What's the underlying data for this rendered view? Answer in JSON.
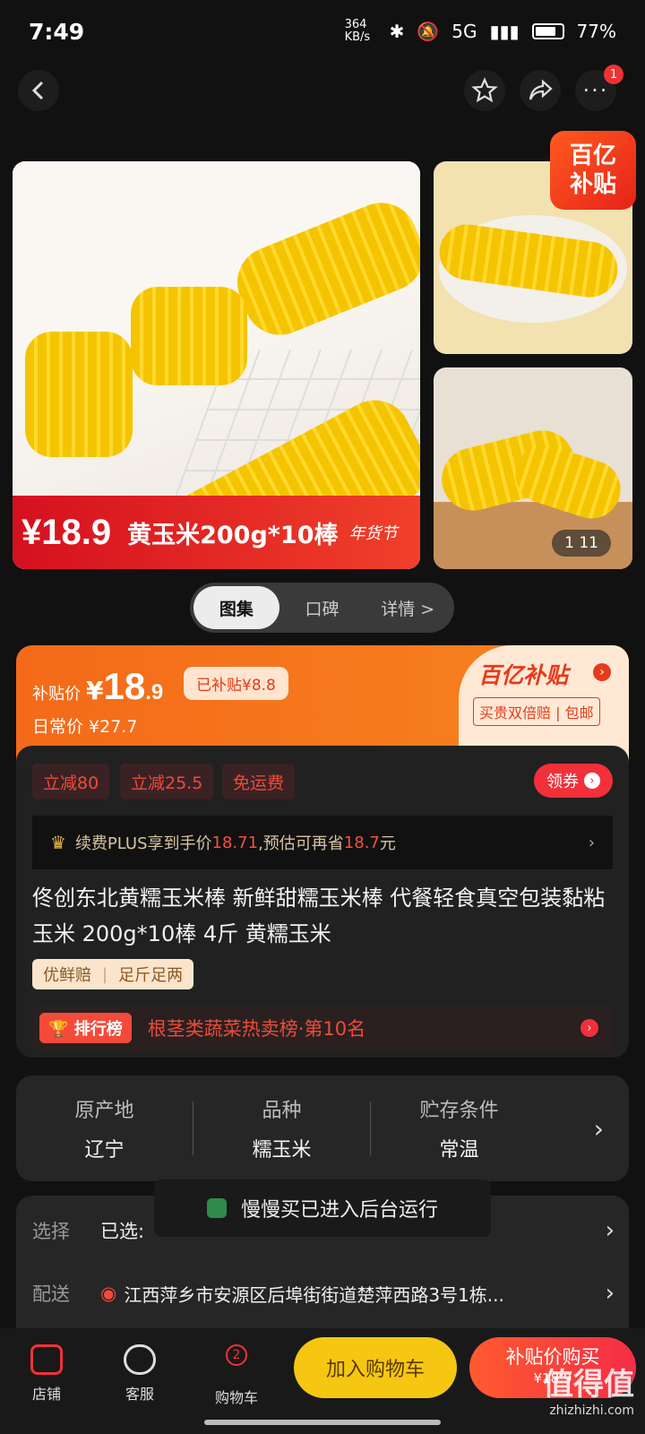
{
  "status": {
    "time": "7:49",
    "speed": "364 KB/s",
    "network": "5G",
    "battery": "77%"
  },
  "nav": {
    "more_badge": "1"
  },
  "gallery": {
    "main_price": "¥18.9",
    "main_title": "黄玉米200g*10棒",
    "main_tag": "年货节",
    "counter": "1 11",
    "promo_tag_line1": "百亿",
    "promo_tag_line2": "补贴"
  },
  "tabs": [
    "图集",
    "口碑",
    "详情 >"
  ],
  "price": {
    "label": "补贴价",
    "yen": "¥",
    "integer": "18",
    "decimal": ".9",
    "subsidy": "已补贴¥8.8",
    "regular": "日常价 ¥27.7",
    "brand": "百亿补贴",
    "brand_sub": "买贵双倍赔 | 包邮"
  },
  "promos": {
    "chips": [
      "立减80",
      "立减25.5",
      "免运费"
    ],
    "coupon": "领券"
  },
  "plus": {
    "text_a": "续费PLUS享到手价",
    "price": "18.71",
    "text_b": ",预估可再省",
    "save": "18.7",
    "text_c": "元"
  },
  "product": {
    "title": "佟创东北黄糯玉米棒 新鲜甜糯玉米棒 代餐轻食真空包装黏粘玉米 200g*10棒 4斤 黄糯玉米",
    "tags": [
      "优鲜赔",
      "足斤足两"
    ],
    "rank_badge": "排行榜",
    "rank_text": "根茎类蔬菜热卖榜·第10名"
  },
  "attributes": [
    {
      "key": "原产地",
      "value": "辽宁"
    },
    {
      "key": "品种",
      "value": "糯玉米"
    },
    {
      "key": "贮存条件",
      "value": "常温"
    }
  ],
  "selection": {
    "select_label": "选择",
    "select_value": "已选:",
    "ship_label": "配送",
    "ship_value": "江西萍乡市安源区后埠街街道楚萍西路3号1栋..."
  },
  "toast": "慢慢买已进入后台运行",
  "bottom": {
    "store": "店铺",
    "service": "客服",
    "cart": "购物车",
    "cart_badge": "2",
    "add_cart": "加入购物车",
    "buy": "补贴价购买",
    "buy_price": "¥18.9"
  },
  "watermark": {
    "line1": "值得值",
    "line2": "zhizhizhi.com"
  }
}
